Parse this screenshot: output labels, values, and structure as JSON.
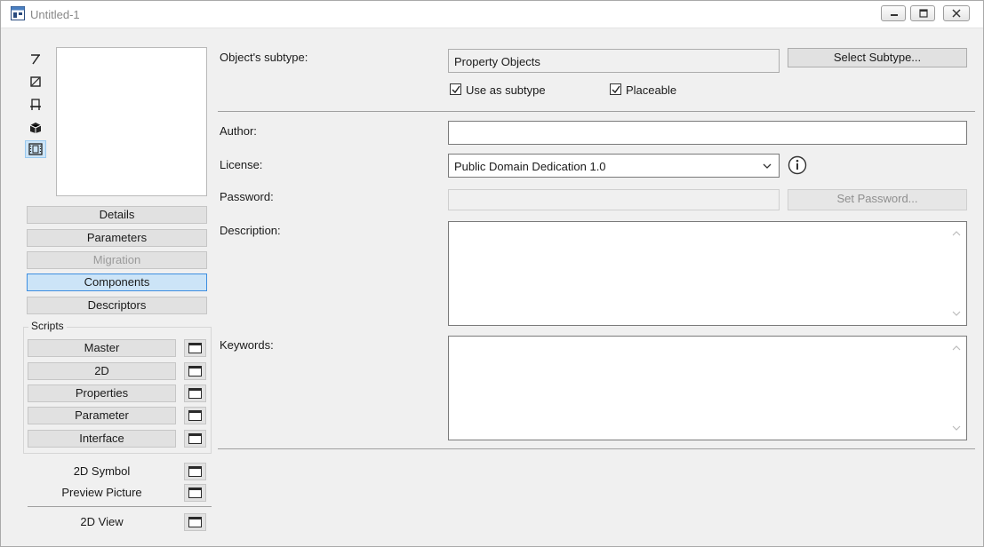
{
  "window": {
    "title": "Untitled-1"
  },
  "sidebar": {
    "buttons": {
      "details": "Details",
      "parameters": "Parameters",
      "migration": "Migration",
      "components": "Components",
      "descriptors": "Descriptors"
    },
    "scripts_label": "Scripts",
    "scripts": {
      "master": "Master",
      "d2": "2D",
      "properties": "Properties",
      "parameter": "Parameter",
      "interface": "Interface"
    },
    "symbol_2d": "2D Symbol",
    "preview_picture": "Preview Picture",
    "view_2d": "2D View",
    "icons": [
      "selector-icon",
      "rect-icon",
      "chair-icon",
      "box-3d-icon",
      "film-icon"
    ],
    "active_item": "Components",
    "disabled_item": "Migration"
  },
  "main": {
    "subtype_label": "Object's subtype:",
    "subtype_value": "Property Objects",
    "select_subtype": "Select Subtype...",
    "use_as_subtype": "Use as subtype",
    "use_as_subtype_checked": true,
    "placeable": "Placeable",
    "placeable_checked": true,
    "author_label": "Author:",
    "author_value": "",
    "license_label": "License:",
    "license_value": "Public Domain Dedication 1.0",
    "password_label": "Password:",
    "password_value": "",
    "set_password": "Set Password...",
    "description_label": "Description:",
    "description_value": "",
    "keywords_label": "Keywords:",
    "keywords_value": ""
  },
  "colors": {
    "accent": "#3d8ee0",
    "selected_bg": "#cce4f7"
  }
}
